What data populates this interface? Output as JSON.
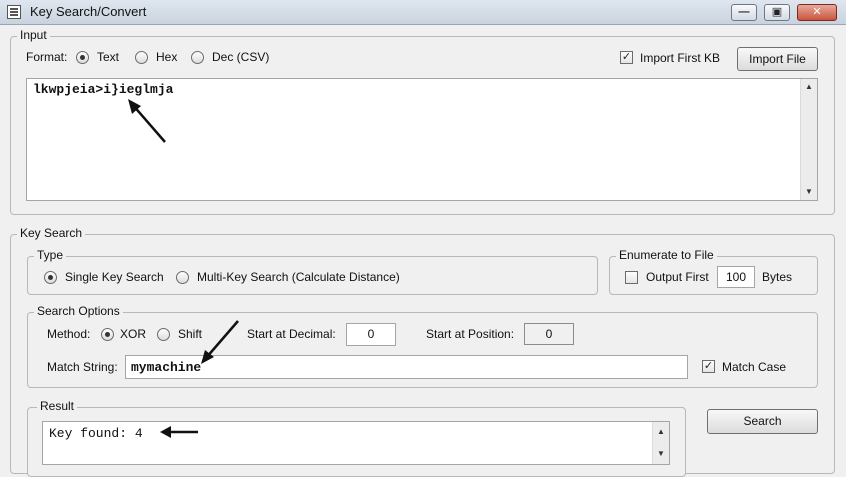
{
  "window": {
    "title": "Key Search/Convert",
    "controls": [
      "—",
      "▣",
      "✕"
    ]
  },
  "input": {
    "group_label": "Input",
    "format_label": "Format:",
    "formats": [
      "Text",
      "Hex",
      "Dec (CSV)"
    ],
    "selected_format": "Text",
    "import_first_kb_label": "Import First KB",
    "import_first_kb_checked": true,
    "import_file_button": "Import File",
    "text_value": "lkwpjeia>i}ieglmja"
  },
  "key_search": {
    "group_label": "Key Search",
    "type": {
      "group_label": "Type",
      "single_label": "Single Key Search",
      "multi_label": "Multi-Key Search (Calculate Distance)",
      "selected": "Single Key Search"
    },
    "enumerate": {
      "group_label": "Enumerate to File",
      "output_first_label": "Output First",
      "output_first_checked": false,
      "count_value": "100",
      "bytes_label": "Bytes"
    },
    "options": {
      "group_label": "Search Options",
      "method_label": "Method:",
      "xor_label": "XOR",
      "shift_label": "Shift",
      "selected_method": "XOR",
      "start_decimal_label": "Start at Decimal:",
      "start_decimal_value": "0",
      "start_position_label": "Start at Position:",
      "start_position_value": "0",
      "match_string_label": "Match String:",
      "match_string_value": "mymachine",
      "match_case_label": "Match Case",
      "match_case_checked": true
    },
    "result": {
      "group_label": "Result",
      "text": "Key found: 4"
    },
    "search_button": "Search"
  },
  "check_glyph": "✓",
  "scroll_up_glyph": "▲",
  "scroll_down_glyph": "▼"
}
